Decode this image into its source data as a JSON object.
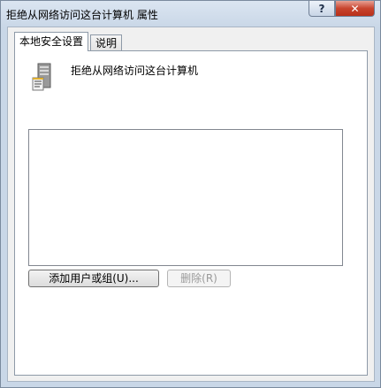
{
  "window": {
    "title": "拒绝从网络访问这台计算机 属性",
    "help_glyph": "?",
    "close_glyph": "✕"
  },
  "tabs": [
    {
      "label": "本地安全设置",
      "active": true
    },
    {
      "label": "说明",
      "active": false
    }
  ],
  "policy": {
    "icon": "server-icon",
    "name": "拒绝从网络访问这台计算机"
  },
  "user_list": {
    "items": []
  },
  "buttons": {
    "add_label": "添加用户或组(U)...",
    "remove_label": "删除(R)"
  }
}
